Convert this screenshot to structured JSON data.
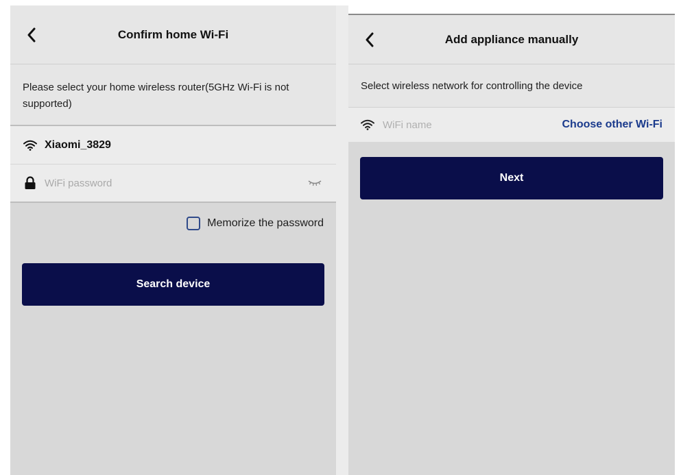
{
  "left_screen": {
    "header": {
      "title": "Confirm home Wi-Fi",
      "back_icon": "chevron-left-icon"
    },
    "instruction": "Please select your home wireless router(5GHz Wi-Fi is not supported)",
    "network": {
      "ssid": "Xiaomi_3829",
      "icon": "wifi-icon"
    },
    "password": {
      "placeholder": "WiFi password",
      "value": "",
      "icon": "lock-icon",
      "toggle_icon": "eye-closed-icon"
    },
    "memorize": {
      "label": "Memorize the password",
      "checked": false
    },
    "primary_button": {
      "label": "Search device"
    }
  },
  "right_screen": {
    "header": {
      "title": "Add appliance manually",
      "back_icon": "chevron-left-icon"
    },
    "instruction": "Select wireless network for controlling the device",
    "wifi": {
      "placeholder": "WiFi name",
      "value": "",
      "icon": "wifi-icon",
      "choose_label": "Choose other Wi-Fi"
    },
    "primary_button": {
      "label": "Next"
    }
  },
  "colors": {
    "primary_button": "#0a0e4a",
    "link": "#1a3a8c",
    "checkbox_border": "#2f4a8a",
    "background": "#d8d8d8"
  }
}
